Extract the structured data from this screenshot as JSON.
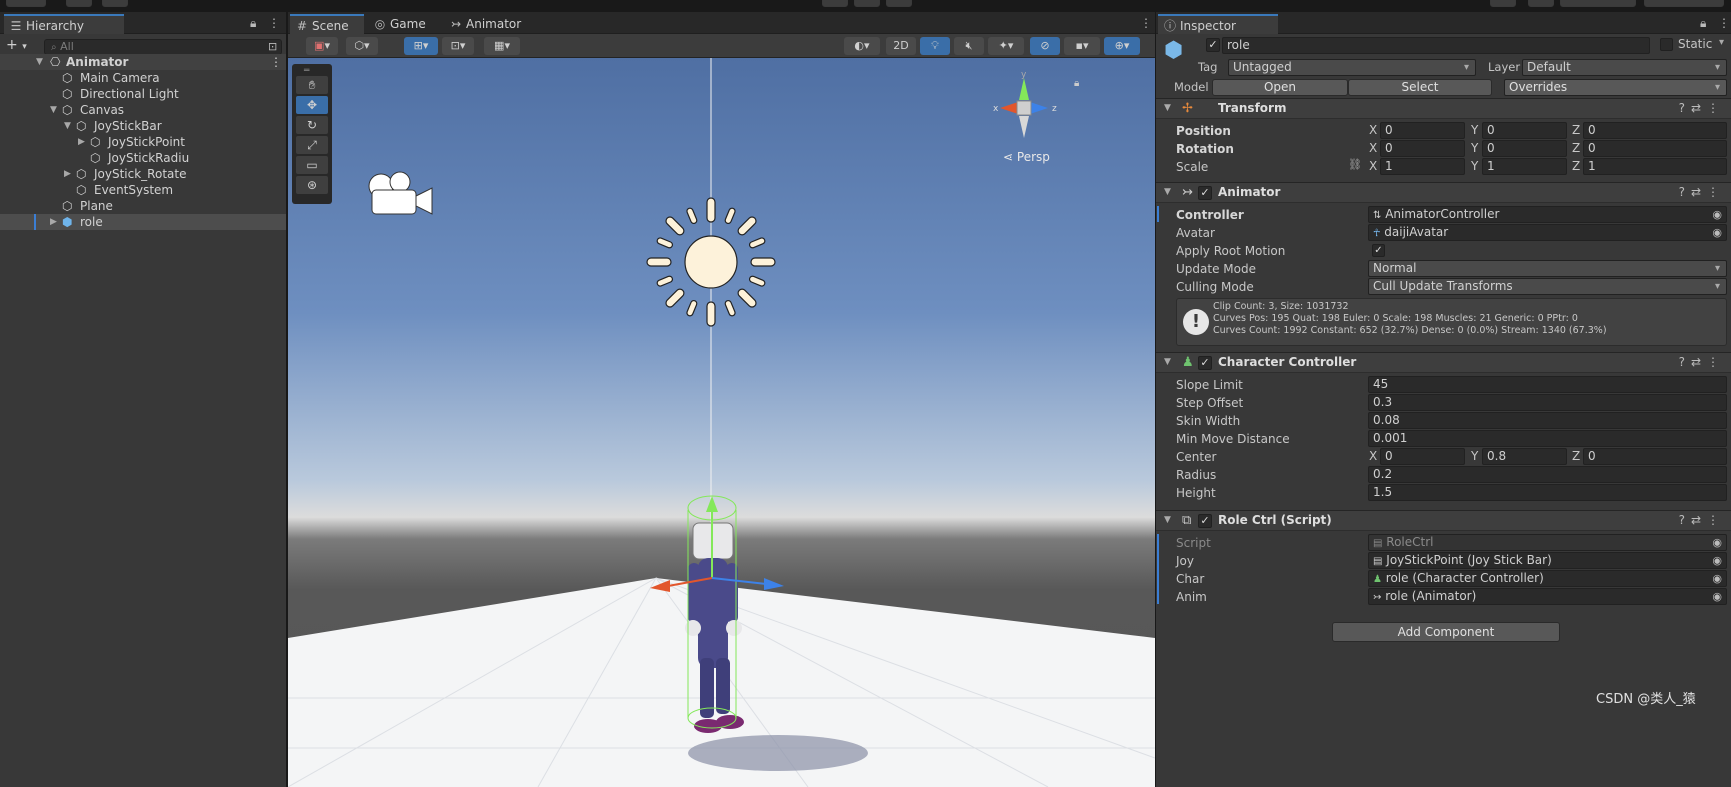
{
  "colors": {
    "accent": "#3a79bb",
    "panel": "#383838",
    "sky_top": "#4f6fa3",
    "ground": "#555555"
  },
  "hierarchy": {
    "tab_label": "Hierarchy",
    "search_placeholder": "All",
    "items": [
      {
        "label": "Animator",
        "icon": "unity-scene-icon",
        "expanded": true
      },
      {
        "label": "Main Camera",
        "icon": "gameobject-icon"
      },
      {
        "label": "Directional Light",
        "icon": "gameobject-icon"
      },
      {
        "label": "Canvas",
        "icon": "gameobject-icon",
        "expanded": true
      },
      {
        "label": "JoyStickBar",
        "icon": "gameobject-icon",
        "expanded": true
      },
      {
        "label": "JoyStickPoint",
        "icon": "gameobject-icon",
        "collapsed": true
      },
      {
        "label": "JoyStickRadiu",
        "icon": "gameobject-icon"
      },
      {
        "label": "JoyStick_Rotate",
        "icon": "gameobject-icon",
        "collapsed": true
      },
      {
        "label": "EventSystem",
        "icon": "gameobject-icon"
      },
      {
        "label": "Plane",
        "icon": "gameobject-icon"
      },
      {
        "label": "role",
        "icon": "prefab-icon",
        "collapsed": true,
        "selected": true
      }
    ]
  },
  "scene": {
    "tabs": [
      {
        "label": "Scene",
        "icon": "grid-icon",
        "active": true
      },
      {
        "label": "Game",
        "icon": "gamepad-icon"
      },
      {
        "label": "Animator",
        "icon": "animator-icon"
      }
    ],
    "toolbar": {
      "mode_2d": "2D"
    },
    "gizmo": {
      "persp_label": "Persp",
      "axes": [
        "y",
        "x",
        "z"
      ]
    }
  },
  "inspector": {
    "tab_label": "Inspector",
    "object_name": "role",
    "static_label": "Static",
    "tag_label": "Tag",
    "tag_value": "Untagged",
    "layer_label": "Layer",
    "layer_value": "Default",
    "model_label": "Model",
    "model_open": "Open",
    "model_select": "Select",
    "model_overrides": "Overrides",
    "transform": {
      "title": "Transform",
      "position_label": "Position",
      "position": {
        "x": "0",
        "y": "0",
        "z": "0"
      },
      "rotation_label": "Rotation",
      "rotation": {
        "x": "0",
        "y": "0",
        "z": "0"
      },
      "scale_label": "Scale",
      "scale": {
        "x": "1",
        "y": "1",
        "z": "1"
      }
    },
    "animator": {
      "title": "Animator",
      "controller_label": "Controller",
      "controller": "AnimatorController",
      "avatar_label": "Avatar",
      "avatar": "daijiAvatar",
      "root_motion_label": "Apply Root Motion",
      "update_mode_label": "Update Mode",
      "update_mode": "Normal",
      "culling_mode_label": "Culling Mode",
      "culling_mode": "Cull Update Transforms",
      "info_lines": [
        "Clip Count: 3, Size: 1031732",
        "Curves Pos: 195 Quat: 198 Euler: 0 Scale: 198 Muscles: 21 Generic: 0 PPtr: 0",
        "Curves Count: 1992 Constant: 652 (32.7%) Dense: 0 (0.0%) Stream: 1340 (67.3%)"
      ]
    },
    "character_controller": {
      "title": "Character Controller",
      "slope_limit_label": "Slope Limit",
      "slope_limit": "45",
      "step_offset_label": "Step Offset",
      "step_offset": "0.3",
      "skin_width_label": "Skin Width",
      "skin_width": "0.08",
      "min_move_label": "Min Move Distance",
      "min_move": "0.001",
      "center_label": "Center",
      "center": {
        "x": "0",
        "y": "0.8",
        "z": "0"
      },
      "radius_label": "Radius",
      "radius": "0.2",
      "height_label": "Height",
      "height": "1.5"
    },
    "role_ctrl": {
      "title": "Role Ctrl (Script)",
      "script_label": "Script",
      "script": "RoleCtrl",
      "joy_label": "Joy",
      "joy": "JoyStickPoint (Joy Stick Bar)",
      "char_label": "Char",
      "char": "role (Character Controller)",
      "anim_label": "Anim",
      "anim": "role (Animator)"
    },
    "add_component": "Add Component"
  },
  "watermark": "CSDN @类人_猿"
}
